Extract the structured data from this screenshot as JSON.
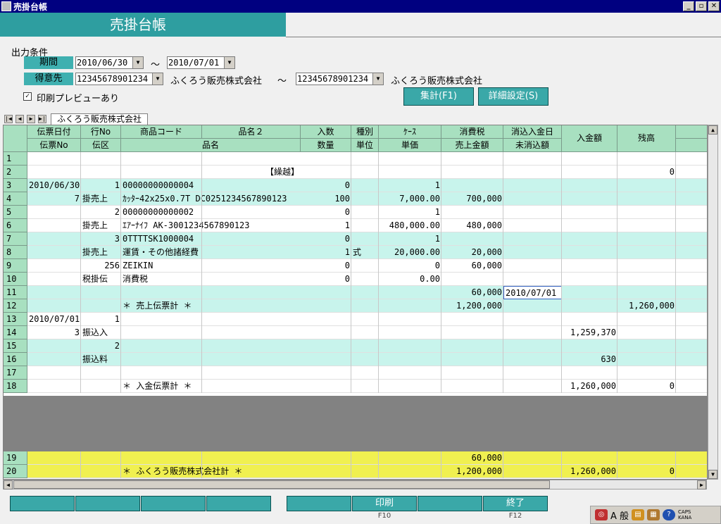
{
  "window": {
    "title": "売掛台帳"
  },
  "banner": {
    "title": "売掛台帳"
  },
  "conditions": {
    "label": "出力条件",
    "period_label": "期間",
    "period_from": "2010/06/30",
    "period_tilde": "～",
    "period_to": "2010/07/01",
    "customer_label": "得意先",
    "customer_from_code": "12345678901234",
    "customer_from_name": "ふくろう販売株式会社",
    "customer_tilde": "～",
    "customer_to_code": "12345678901234",
    "customer_to_name": "ふくろう販売株式会社",
    "preview_label": "印刷プレビューあり",
    "preview_checked": "✓"
  },
  "buttons": {
    "aggregate": "集計(F1)",
    "detail": "詳細設定(S)"
  },
  "sheet_tab": "ふくろう販売株式会社",
  "columns": {
    "row1": [
      "伝票日付",
      "行No",
      "商品コード",
      "品名２",
      "入数",
      "種別",
      "ｹｰｽ",
      "消費税",
      "消込入金日"
    ],
    "row2": [
      "伝票No",
      "伝区",
      "品名",
      "数量",
      "単位",
      "単価",
      "売上金額",
      "未消込額"
    ],
    "merged": [
      "入金額",
      "残高"
    ]
  },
  "rows": [
    {
      "n": "1"
    },
    {
      "n": "2",
      "name": "【繰越】",
      "balance": "0"
    },
    {
      "n": "3",
      "date": "2010/06/30",
      "line": "1",
      "code": "00000000000004",
      "qty": "0",
      "price": "1"
    },
    {
      "n": "4",
      "date": "7",
      "line": "掛売上",
      "code": "ｶｯﾀｰ42x25x0.7T  DC0251234567890123",
      "qty": "100",
      "price": "7,000.00",
      "tax": "700,000"
    },
    {
      "n": "5",
      "line": "2",
      "code": "00000000000002",
      "qty": "0",
      "price": "1"
    },
    {
      "n": "6",
      "line": "掛売上",
      "code": "ｴｱｰﾅｲﾌ AK-3001234567890123",
      "qty": "1",
      "price": "480,000.00",
      "tax": "480,000"
    },
    {
      "n": "7",
      "line": "3",
      "code": "0TTTTSK1000004",
      "qty": "0",
      "price": "1"
    },
    {
      "n": "8",
      "line": "掛売上",
      "code": "運賃・その他諸経費",
      "qty": "1",
      "unit": "式",
      "price": "20,000.00",
      "tax": "20,000"
    },
    {
      "n": "9",
      "line": "256",
      "code": "ZEIKIN",
      "qty": "0",
      "price": "0",
      "tax": "60,000"
    },
    {
      "n": "10",
      "line": "税掛伝",
      "code": "消費税",
      "qty": "0",
      "price": "0.00"
    },
    {
      "n": "11",
      "tax": "60,000",
      "keshi": "2010/07/01"
    },
    {
      "n": "12",
      "code": "＊  売上伝票計  ＊",
      "tax": "1,200,000",
      "balance": "1,260,000"
    },
    {
      "n": "13",
      "date": "2010/07/01",
      "line": "1"
    },
    {
      "n": "14",
      "date": "3",
      "line": "振込入",
      "deposit": "1,259,370"
    },
    {
      "n": "15",
      "line": "2"
    },
    {
      "n": "16",
      "line": "振込料",
      "deposit": "630"
    },
    {
      "n": "17"
    },
    {
      "n": "18",
      "code": "＊  入金伝票計  ＊",
      "deposit": "1,260,000",
      "balance": "0"
    }
  ],
  "footer_rows": [
    {
      "n": "19",
      "tax": "60,000"
    },
    {
      "n": "20",
      "code": "＊  ふくろう販売株式会社計  ＊",
      "tax": "1,200,000",
      "deposit": "1,260,000",
      "balance": "0"
    }
  ],
  "fkeys": {
    "print": "印刷",
    "print_key": "F10",
    "end": "終了",
    "end_key": "F12"
  },
  "tray": {
    "ime": "A 般",
    "caps": "CAPS",
    "kana": "KANA"
  },
  "colors": {
    "banner": "#2e9ea0",
    "header": "#a8e0c0",
    "band": "#c8f4ec",
    "total": "#f0f050",
    "fkey": "#3aa8a8"
  }
}
